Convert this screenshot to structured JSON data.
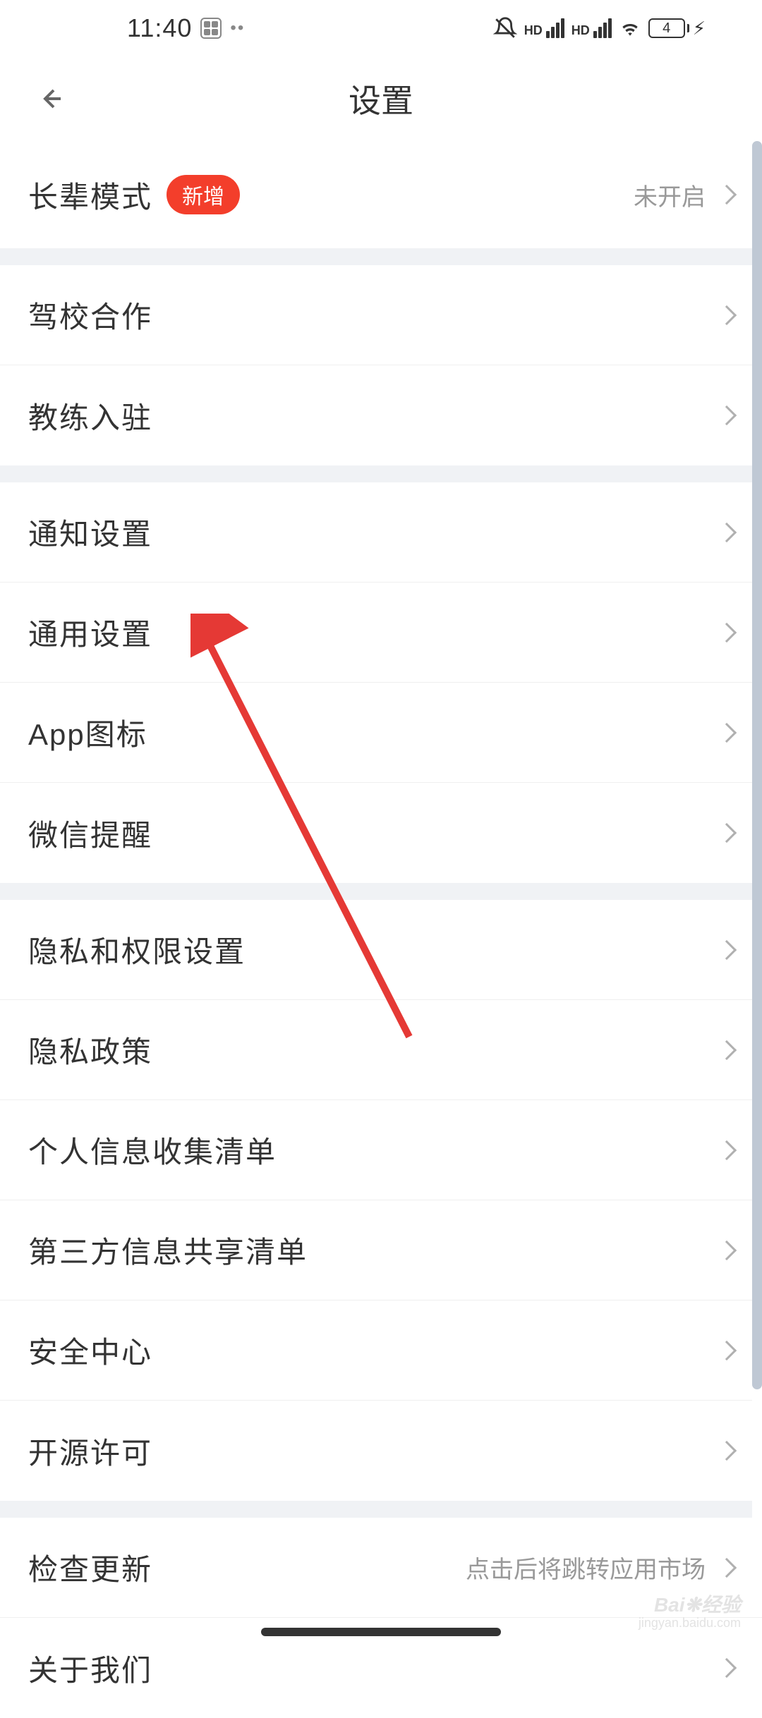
{
  "statusBar": {
    "time": "11:40",
    "batteryLevel": "4"
  },
  "header": {
    "title": "设置"
  },
  "sections": [
    {
      "rows": [
        {
          "label": "长辈模式",
          "badge": "新增",
          "value": "未开启"
        }
      ]
    },
    {
      "rows": [
        {
          "label": "驾校合作"
        },
        {
          "label": "教练入驻"
        }
      ]
    },
    {
      "rows": [
        {
          "label": "通知设置"
        },
        {
          "label": "通用设置"
        },
        {
          "label": "App图标"
        },
        {
          "label": "微信提醒"
        }
      ]
    },
    {
      "rows": [
        {
          "label": "隐私和权限设置"
        },
        {
          "label": "隐私政策"
        },
        {
          "label": "个人信息收集清单"
        },
        {
          "label": "第三方信息共享清单"
        },
        {
          "label": "安全中心"
        },
        {
          "label": "开源许可"
        }
      ]
    },
    {
      "rows": [
        {
          "label": "检查更新",
          "value": "点击后将跳转应用市场"
        },
        {
          "label": "关于我们"
        }
      ]
    }
  ],
  "watermark": {
    "main": "Bai❋经验",
    "sub": "jingyan.baidu.com"
  },
  "colors": {
    "accent": "#f33e2b",
    "background": "#f0f2f5",
    "divider": "#efefef",
    "textPrimary": "#333333",
    "textSecondary": "#999999"
  }
}
